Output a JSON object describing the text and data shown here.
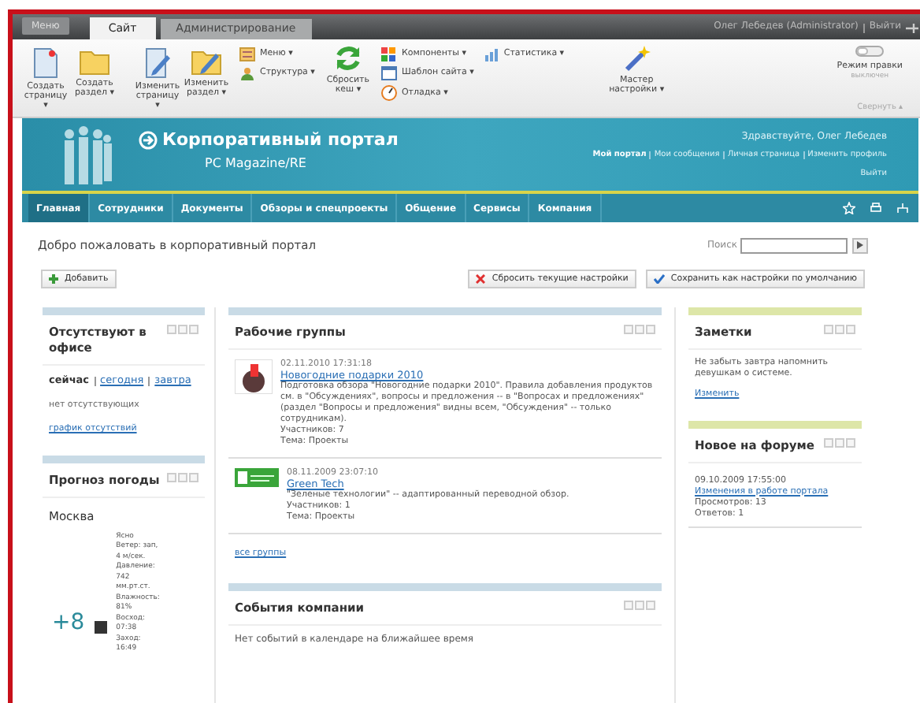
{
  "admin_bar": {
    "menu_button": "Меню",
    "tabs": [
      {
        "label": "Сайт",
        "selected": true
      },
      {
        "label": "Администрирование",
        "selected": false
      }
    ],
    "user": "Олег Лебедев (Administrator)",
    "logout": "Выйти"
  },
  "ribbon": {
    "big_buttons": [
      {
        "label": "Создать страницу ▾"
      },
      {
        "label": "Создать раздел ▾"
      },
      {
        "label": "Изменить страницу ▾"
      },
      {
        "label": "Изменить раздел ▾"
      }
    ],
    "menu_group": [
      {
        "label": "Меню ▾"
      },
      {
        "label": "Структура ▾"
      }
    ],
    "cache_button": {
      "label": "Сбросить кеш ▾"
    },
    "tools_group": [
      {
        "label": "Компоненты ▾"
      },
      {
        "label": "Шаблон сайта ▾"
      },
      {
        "label": "Отладка ▾"
      }
    ],
    "stats": {
      "label": "Статистика ▾"
    },
    "wizard": {
      "label": "Мастер настройки ▾"
    },
    "edit_mode": {
      "label": "Режим правки",
      "state": "выключен",
      "on": false
    },
    "collapse": "Свернуть ▴"
  },
  "header": {
    "title": "Корпоративный портал",
    "subtitle": "PC Magazine/RE",
    "greeting": "Здравствуйте, Олег Лебедев",
    "links": [
      {
        "label": "Мой портал",
        "current": true
      },
      {
        "label": "Мои сообщения",
        "current": false
      },
      {
        "label": "Личная страница",
        "current": false
      },
      {
        "label": "Изменить профиль",
        "current": false
      }
    ],
    "logout": "Выйти"
  },
  "nav": [
    {
      "label": "Главная",
      "selected": true
    },
    {
      "label": "Сотрудники",
      "selected": false
    },
    {
      "label": "Документы",
      "selected": false
    },
    {
      "label": "Обзоры и спецпроекты",
      "selected": false
    },
    {
      "label": "Общение",
      "selected": false
    },
    {
      "label": "Сервисы",
      "selected": false
    },
    {
      "label": "Компания",
      "selected": false
    }
  ],
  "page": {
    "title": "Добро пожаловать в корпоративный портал",
    "search_label": "Поиск",
    "add_button": "Добавить",
    "reset_button": "Сбросить текущие настройки",
    "save_button": "Сохранить как настройки по умолчанию"
  },
  "absent": {
    "title": "Отсутствуют в офисе",
    "tabs": [
      {
        "label": "сейчас",
        "selected": true
      },
      {
        "label": "сегодня",
        "selected": false
      },
      {
        "label": "завтра",
        "selected": false
      }
    ],
    "empty": "нет отсутствующих",
    "link": "график отсутствий"
  },
  "weather": {
    "title": "Прогноз погоды",
    "city": "Москва",
    "temperature": "+8",
    "details": [
      "Ясно",
      "Ветер: зап, 4 м/сек.",
      "Давление: 742 мм.рт.ст.",
      "Влажность: 81%",
      "Восход: 07:38",
      "Заход: 16:49"
    ]
  },
  "groups": {
    "title": "Рабочие группы",
    "items": [
      {
        "date": "02.11.2010 17:31:18",
        "name": "Новогодние подарки 2010",
        "text": "Подготовка обзора \"Новогодние подарки 2010\". Правила добавления продуктов см. в \"Обсуждениях\", вопросы и предложения -- в \"Вопросах и предложениях\" (раздел \"Вопросы и предложения\" видны всем, \"Обсуждения\" -- только сотрудникам).",
        "members": "Участников: 7",
        "topic": "Тема: Проекты"
      },
      {
        "date": "08.11.2009 23:07:10",
        "name": "Green Tech",
        "text": "\"Зеленые технологии\" -- адаптированный переводной обзор.",
        "members": "Участников: 1",
        "topic": "Тема: Проекты"
      }
    ],
    "all_link": "все группы"
  },
  "events": {
    "title": "События компании",
    "text": "Нет событий в календаре на ближайшее время"
  },
  "notes": {
    "title": "Заметки",
    "text": "Не забыть завтра напомнить девушкам о системе.",
    "link": "Изменить"
  },
  "forum": {
    "title": "Новое на форуме",
    "date": "09.10.2009 17:55:00",
    "topic": "Изменения в работе портала",
    "views": "Просмотров: 13",
    "replies": "Ответов: 1"
  }
}
